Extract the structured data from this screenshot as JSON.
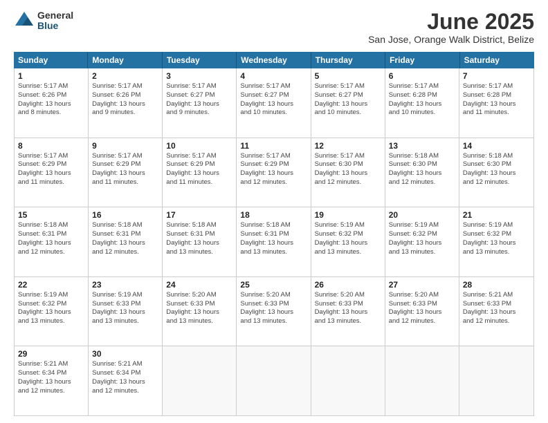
{
  "header": {
    "logo_general": "General",
    "logo_blue": "Blue",
    "month_title": "June 2025",
    "location": "San Jose, Orange Walk District, Belize"
  },
  "weekdays": [
    "Sunday",
    "Monday",
    "Tuesday",
    "Wednesday",
    "Thursday",
    "Friday",
    "Saturday"
  ],
  "rows": [
    [
      {
        "day": "1",
        "info": "Sunrise: 5:17 AM\nSunset: 6:26 PM\nDaylight: 13 hours\nand 8 minutes."
      },
      {
        "day": "2",
        "info": "Sunrise: 5:17 AM\nSunset: 6:26 PM\nDaylight: 13 hours\nand 9 minutes."
      },
      {
        "day": "3",
        "info": "Sunrise: 5:17 AM\nSunset: 6:27 PM\nDaylight: 13 hours\nand 9 minutes."
      },
      {
        "day": "4",
        "info": "Sunrise: 5:17 AM\nSunset: 6:27 PM\nDaylight: 13 hours\nand 10 minutes."
      },
      {
        "day": "5",
        "info": "Sunrise: 5:17 AM\nSunset: 6:27 PM\nDaylight: 13 hours\nand 10 minutes."
      },
      {
        "day": "6",
        "info": "Sunrise: 5:17 AM\nSunset: 6:28 PM\nDaylight: 13 hours\nand 10 minutes."
      },
      {
        "day": "7",
        "info": "Sunrise: 5:17 AM\nSunset: 6:28 PM\nDaylight: 13 hours\nand 11 minutes."
      }
    ],
    [
      {
        "day": "8",
        "info": "Sunrise: 5:17 AM\nSunset: 6:29 PM\nDaylight: 13 hours\nand 11 minutes."
      },
      {
        "day": "9",
        "info": "Sunrise: 5:17 AM\nSunset: 6:29 PM\nDaylight: 13 hours\nand 11 minutes."
      },
      {
        "day": "10",
        "info": "Sunrise: 5:17 AM\nSunset: 6:29 PM\nDaylight: 13 hours\nand 11 minutes."
      },
      {
        "day": "11",
        "info": "Sunrise: 5:17 AM\nSunset: 6:29 PM\nDaylight: 13 hours\nand 12 minutes."
      },
      {
        "day": "12",
        "info": "Sunrise: 5:17 AM\nSunset: 6:30 PM\nDaylight: 13 hours\nand 12 minutes."
      },
      {
        "day": "13",
        "info": "Sunrise: 5:18 AM\nSunset: 6:30 PM\nDaylight: 13 hours\nand 12 minutes."
      },
      {
        "day": "14",
        "info": "Sunrise: 5:18 AM\nSunset: 6:30 PM\nDaylight: 13 hours\nand 12 minutes."
      }
    ],
    [
      {
        "day": "15",
        "info": "Sunrise: 5:18 AM\nSunset: 6:31 PM\nDaylight: 13 hours\nand 12 minutes."
      },
      {
        "day": "16",
        "info": "Sunrise: 5:18 AM\nSunset: 6:31 PM\nDaylight: 13 hours\nand 12 minutes."
      },
      {
        "day": "17",
        "info": "Sunrise: 5:18 AM\nSunset: 6:31 PM\nDaylight: 13 hours\nand 13 minutes."
      },
      {
        "day": "18",
        "info": "Sunrise: 5:18 AM\nSunset: 6:31 PM\nDaylight: 13 hours\nand 13 minutes."
      },
      {
        "day": "19",
        "info": "Sunrise: 5:19 AM\nSunset: 6:32 PM\nDaylight: 13 hours\nand 13 minutes."
      },
      {
        "day": "20",
        "info": "Sunrise: 5:19 AM\nSunset: 6:32 PM\nDaylight: 13 hours\nand 13 minutes."
      },
      {
        "day": "21",
        "info": "Sunrise: 5:19 AM\nSunset: 6:32 PM\nDaylight: 13 hours\nand 13 minutes."
      }
    ],
    [
      {
        "day": "22",
        "info": "Sunrise: 5:19 AM\nSunset: 6:32 PM\nDaylight: 13 hours\nand 13 minutes."
      },
      {
        "day": "23",
        "info": "Sunrise: 5:19 AM\nSunset: 6:33 PM\nDaylight: 13 hours\nand 13 minutes."
      },
      {
        "day": "24",
        "info": "Sunrise: 5:20 AM\nSunset: 6:33 PM\nDaylight: 13 hours\nand 13 minutes."
      },
      {
        "day": "25",
        "info": "Sunrise: 5:20 AM\nSunset: 6:33 PM\nDaylight: 13 hours\nand 13 minutes."
      },
      {
        "day": "26",
        "info": "Sunrise: 5:20 AM\nSunset: 6:33 PM\nDaylight: 13 hours\nand 13 minutes."
      },
      {
        "day": "27",
        "info": "Sunrise: 5:20 AM\nSunset: 6:33 PM\nDaylight: 13 hours\nand 12 minutes."
      },
      {
        "day": "28",
        "info": "Sunrise: 5:21 AM\nSunset: 6:33 PM\nDaylight: 13 hours\nand 12 minutes."
      }
    ],
    [
      {
        "day": "29",
        "info": "Sunrise: 5:21 AM\nSunset: 6:34 PM\nDaylight: 13 hours\nand 12 minutes."
      },
      {
        "day": "30",
        "info": "Sunrise: 5:21 AM\nSunset: 6:34 PM\nDaylight: 13 hours\nand 12 minutes."
      },
      {
        "day": "",
        "info": ""
      },
      {
        "day": "",
        "info": ""
      },
      {
        "day": "",
        "info": ""
      },
      {
        "day": "",
        "info": ""
      },
      {
        "day": "",
        "info": ""
      }
    ]
  ]
}
